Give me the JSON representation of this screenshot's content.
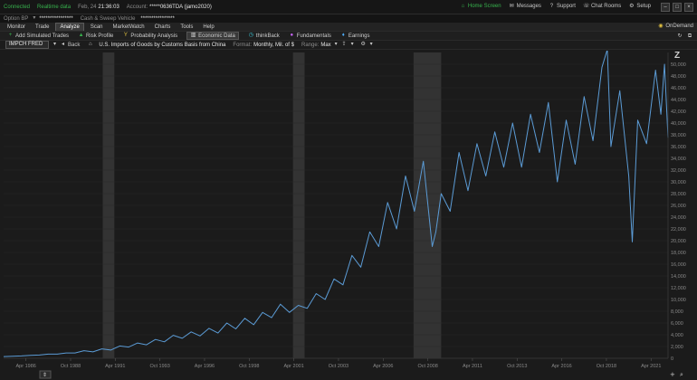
{
  "status": {
    "connection": "Connected",
    "data_mode": "Realtime data",
    "date": "Feb, 24",
    "time": "21:36:03",
    "account_label": "Account:",
    "account_value": "*****0636TDA (jamo2020)"
  },
  "top_links": [
    {
      "label": "Home Screen",
      "icon": "house-icon"
    },
    {
      "label": "Messages",
      "icon": "envelope-icon"
    },
    {
      "label": "Support",
      "icon": "help-icon"
    },
    {
      "label": "Chat Rooms",
      "icon": "chat-icon"
    },
    {
      "label": "Setup",
      "icon": "gear-icon"
    }
  ],
  "account": {
    "option_bp_label": "Option BP",
    "option_bp_value": "****************",
    "cash_label": "Cash & Sweep Vehicle",
    "cash_value": "****************"
  },
  "tabs": [
    "Monitor",
    "Trade",
    "Analyze",
    "Scan",
    "MarketWatch",
    "Charts",
    "Tools",
    "Help"
  ],
  "active_tab": "Analyze",
  "ondemand_label": "OnDemand",
  "subtabs": [
    {
      "label": "Add Simulated Trades",
      "icon": "plus-icon",
      "color": "#37b24d"
    },
    {
      "label": "Risk Profile",
      "icon": "risk-icon",
      "color": "#37b24d"
    },
    {
      "label": "Probability Analysis",
      "icon": "probability-icon",
      "color": "#e0c040"
    },
    {
      "label": "Economic Data",
      "icon": "bank-icon",
      "color": "#cccccc"
    },
    {
      "label": "thinkBack",
      "icon": "clock-icon",
      "color": "#3bc9db"
    },
    {
      "label": "Fundamentals",
      "icon": "people-icon",
      "color": "#cc66ff"
    },
    {
      "label": "Earnings",
      "icon": "lightbulb-icon",
      "color": "#4dabf7"
    }
  ],
  "active_subtab": "Economic Data",
  "toolbar": {
    "symbol": "IMPCH FRED",
    "back_label": "Back",
    "title": "U.S. Imports of Goods by Customs Basis from China",
    "format_label": "Format:",
    "format_value": "Monthly, Mil. of $",
    "range_label": "Range:",
    "range_value": "Max"
  },
  "colors": {
    "line": "#5b9bd5",
    "recession": "#333333",
    "grid": "#2a2a2a",
    "axis_text": "#8a8a8a",
    "background": "#1b1b1b"
  },
  "chart_data": {
    "type": "line",
    "y_ticks": [
      0,
      2000,
      4000,
      6000,
      8000,
      10000,
      12000,
      14000,
      16000,
      18000,
      20000,
      22000,
      24000,
      26000,
      28000,
      30000,
      32000,
      34000,
      36000,
      38000,
      40000,
      42000,
      44000,
      46000,
      48000,
      50000
    ],
    "ylim": [
      0,
      52000
    ],
    "x_ticks": [
      "Apr 1986",
      "Oct 1988",
      "Apr 1991",
      "Oct 1993",
      "Apr 1996",
      "Oct 1998",
      "Apr 2001",
      "Oct 2003",
      "Apr 2006",
      "Oct 2008",
      "Apr 2011",
      "Oct 2013",
      "Apr 2016",
      "Oct 2018",
      "Apr 2021"
    ],
    "xlim": [
      1985.0,
      2022.2
    ],
    "recessions": [
      [
        1990.55,
        1991.2
      ],
      [
        2001.2,
        2001.85
      ],
      [
        2007.95,
        2009.5
      ]
    ],
    "series": [
      {
        "x": [
          1985.0,
          1985.5,
          1986.0,
          1986.5,
          1987.0,
          1987.5,
          1988.0,
          1988.5,
          1989.0,
          1989.5,
          1990.0,
          1990.5,
          1991.0,
          1991.5,
          1992.0,
          1992.5,
          1993.0,
          1993.5,
          1994.0,
          1994.5,
          1995.0,
          1995.5,
          1996.0,
          1996.5,
          1997.0,
          1997.5,
          1998.0,
          1998.5,
          1999.0,
          1999.5,
          2000.0,
          2000.5,
          2001.0,
          2001.5,
          2002.0,
          2002.5,
          2003.0,
          2003.5,
          2004.0,
          2004.5,
          2005.0,
          2005.5,
          2006.0,
          2006.5,
          2007.0,
          2007.5,
          2008.0,
          2008.5,
          2009.0,
          2009.2,
          2009.5,
          2010.0,
          2010.5,
          2011.0,
          2011.5,
          2012.0,
          2012.5,
          2013.0,
          2013.5,
          2014.0,
          2014.5,
          2015.0,
          2015.5,
          2016.0,
          2016.5,
          2017.0,
          2017.5,
          2018.0,
          2018.5,
          2018.8,
          2019.0,
          2019.5,
          2020.0,
          2020.2,
          2020.5,
          2021.0,
          2021.5,
          2021.8,
          2022.0,
          2022.2
        ],
        "y": [
          300,
          350,
          400,
          500,
          550,
          700,
          700,
          900,
          900,
          1300,
          1100,
          1600,
          1400,
          2100,
          1900,
          2600,
          2300,
          3200,
          2800,
          3900,
          3400,
          4500,
          3800,
          5100,
          4300,
          6000,
          5000,
          6800,
          5700,
          7800,
          6900,
          9200,
          7800,
          9000,
          8500,
          11000,
          10000,
          13500,
          12500,
          17500,
          15500,
          21500,
          19000,
          26500,
          22000,
          31000,
          25000,
          33500,
          19000,
          21500,
          28000,
          25000,
          35000,
          28500,
          36500,
          31000,
          38500,
          32500,
          40000,
          32500,
          41500,
          35000,
          43500,
          30000,
          40500,
          33000,
          44500,
          37000,
          49500,
          52500,
          36000,
          45500,
          31000,
          19800,
          40500,
          36500,
          49000,
          41500,
          50000,
          37500
        ]
      }
    ]
  }
}
